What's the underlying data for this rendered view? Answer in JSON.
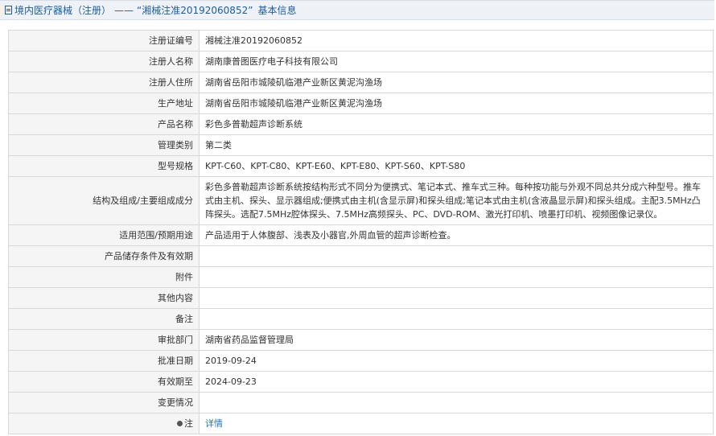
{
  "header": {
    "section": "境内医疗器械（注册）",
    "separator": "——",
    "quote_title": "“湘械注准20192060852”",
    "suffix": "基本信息"
  },
  "rows": [
    {
      "label": "注册证编号",
      "value": "湘械注准20192060852"
    },
    {
      "label": "注册人名称",
      "value": "湖南康普图医疗电子科技有限公司"
    },
    {
      "label": "注册人住所",
      "value": "湖南省岳阳市城陵矶临港产业新区黄泥沟渔场"
    },
    {
      "label": "生产地址",
      "value": "湖南省岳阳市城陵矶临港产业新区黄泥沟渔场"
    },
    {
      "label": "产品名称",
      "value": "彩色多普勒超声诊断系统"
    },
    {
      "label": "管理类别",
      "value": "第二类"
    },
    {
      "label": "型号规格",
      "value": "KPT-C60、KPT-C80、KPT-E60、KPT-E80、KPT-S60、KPT-S80"
    },
    {
      "label": "结构及组成/主要组成成分",
      "value": "彩色多普勒超声诊断系统按结构形式不同分为便携式、笔记本式、推车式三种。每种按功能与外观不同总共分成六种型号。推车式由主机、探头、显示器组成;便携式由主机(含显示屏)和探头组成;笔记本式由主机(含液晶显示屏)和探头组成。主配3.5MHz凸阵探头。选配7.5MHz腔体探头、7.5MHz高频探头、PC、DVD-ROM、激光打印机、喷墨打印机、视频图像记录仪。"
    },
    {
      "label": "适用范围/预期用途",
      "value": "产品适用于人体腹部、浅表及小器官,外周血管的超声诊断检查。"
    },
    {
      "label": "产品储存条件及有效期",
      "value": ""
    },
    {
      "label": "附件",
      "value": ""
    },
    {
      "label": "其他内容",
      "value": ""
    },
    {
      "label": "备注",
      "value": ""
    },
    {
      "label": "审批部门",
      "value": "湖南省药品监督管理局"
    },
    {
      "label": "批准日期",
      "value": "2019-09-24"
    },
    {
      "label": "有效期至",
      "value": "2024-09-23"
    },
    {
      "label": "变更情况",
      "value": ""
    },
    {
      "label": "注",
      "value": "详情"
    }
  ]
}
